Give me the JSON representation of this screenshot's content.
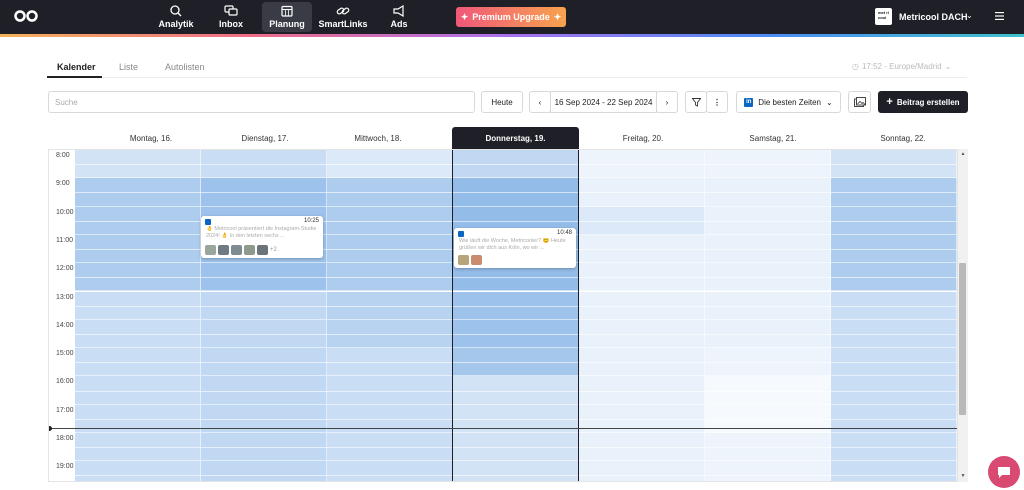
{
  "nav": {
    "items": [
      {
        "label": "Analytik",
        "icon": "magnifier-chart-icon"
      },
      {
        "label": "Inbox",
        "icon": "chat-bubbles-icon"
      },
      {
        "label": "Planung",
        "icon": "calendar-icon"
      },
      {
        "label": "SmartLinks",
        "icon": "link-icon"
      },
      {
        "label": "Ads",
        "icon": "megaphone-icon"
      }
    ],
    "premium_label": "Premium Upgrade",
    "brand_box_text": "met ri cool",
    "brand_name": "Metricool DACH"
  },
  "tabs": [
    "Kalender",
    "Liste",
    "Autolisten"
  ],
  "timezone": "17:52 - Europe/Madrid",
  "toolbar": {
    "search_placeholder": "Suche",
    "today_label": "Heute",
    "date_range": "16 Sep 2024 - 22 Sep 2024",
    "best_times_label": "Die besten Zeiten",
    "create_label": "Beitrag erstellen"
  },
  "calendar": {
    "days": [
      "Montag, 16.",
      "Dienstag, 17.",
      "Mittwoch, 18.",
      "Donnerstag, 19.",
      "Freitag, 20.",
      "Samstag, 21.",
      "Sonntag, 22."
    ],
    "hours": [
      "8:00",
      "9:00",
      "10:00",
      "11:00",
      "12:00",
      "13:00",
      "14:00",
      "15:00",
      "16:00",
      "17:00",
      "18:00",
      "19:00"
    ],
    "posts": [
      {
        "time": "10:25",
        "text": "👌 Metricool präsentiert die Instagram-Studie 2024! 👌 In den letzten sechs ...",
        "more": "+2"
      },
      {
        "time": "10:48",
        "text": "Wie läuft die Woche, Metricooler? 😊 Heute grüßen wir dich aus Köln, wo wir ..."
      }
    ]
  },
  "colors": {
    "accent_dark": "#1f2027",
    "linkedin": "#0a66c2",
    "premium_start": "#f0587a",
    "premium_end": "#f7a34e"
  }
}
